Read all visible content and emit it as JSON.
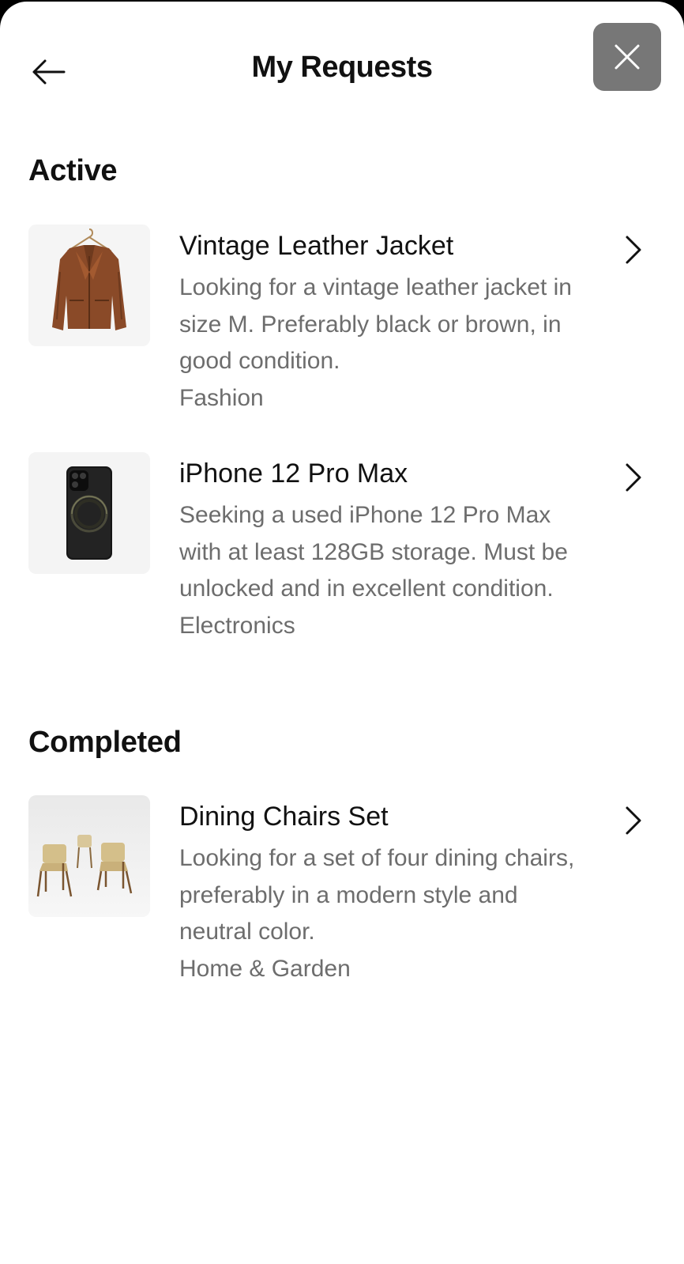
{
  "header": {
    "title": "My Requests",
    "back_icon": "arrow-left-icon",
    "close_icon": "close-icon"
  },
  "sections": {
    "active": {
      "title": "Active",
      "items": [
        {
          "title": "Vintage Leather Jacket",
          "description": "Looking for a vintage leather jacket in size M. Preferably black or brown, in good condition.",
          "category": "Fashion",
          "image": "leather-jacket-image"
        },
        {
          "title": "iPhone 12 Pro Max",
          "description": "Seeking a used iPhone 12 Pro Max with at least 128GB storage. Must be unlocked and in excellent condition.",
          "category": "Electronics",
          "image": "iphone-image"
        }
      ]
    },
    "completed": {
      "title": "Completed",
      "items": [
        {
          "title": "Dining Chairs Set",
          "description": "Looking for a set of four dining chairs, preferably in a modern style and neutral color.",
          "category": "Home & Garden",
          "image": "dining-chairs-image"
        }
      ]
    }
  },
  "colors": {
    "background": "#ffffff",
    "title_text": "#111111",
    "secondary_text": "#6d6d6d",
    "close_button": "#777777"
  }
}
